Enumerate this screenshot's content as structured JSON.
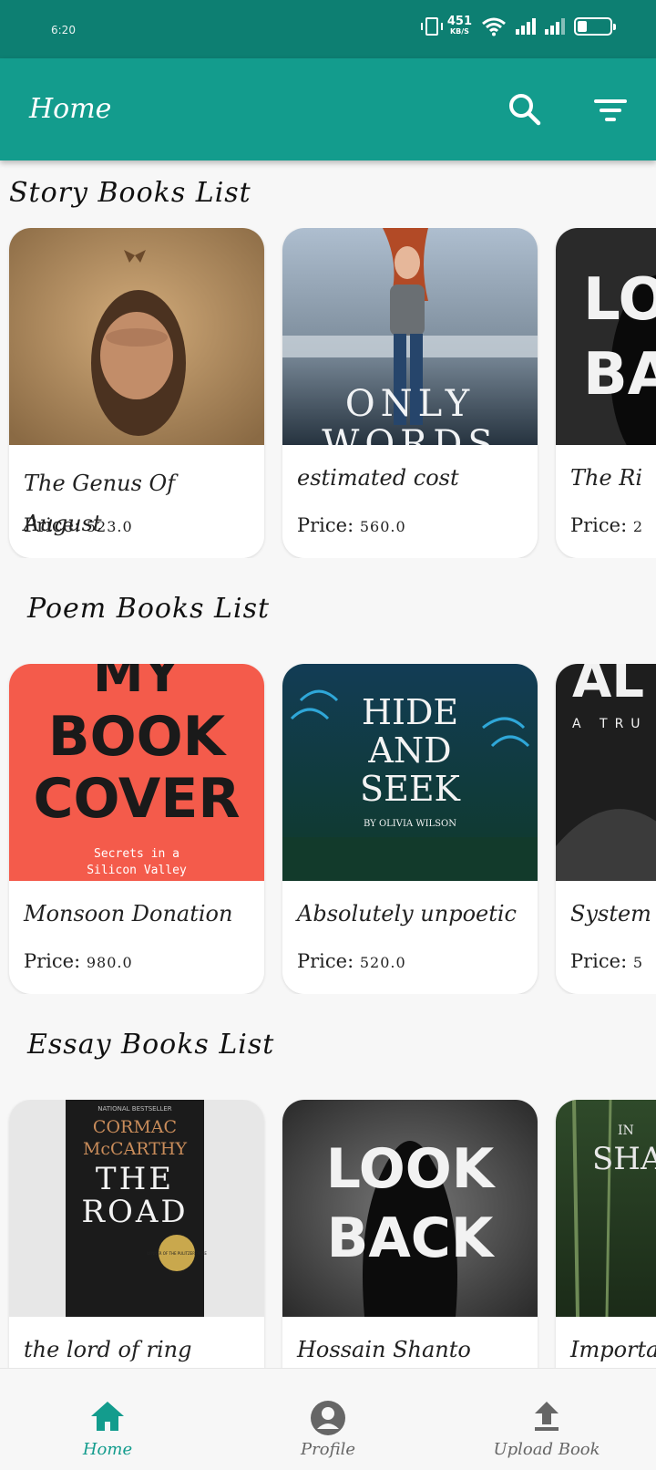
{
  "status_bar": {
    "time": "6:20",
    "net_speed": "451",
    "net_unit": "KB/S",
    "battery_level": "31"
  },
  "app_bar": {
    "title": "Home",
    "color": "#139c8d",
    "icons": [
      "search-icon",
      "filter-icon"
    ]
  },
  "sections": [
    {
      "title": "Story Books List",
      "books": [
        {
          "title_line1": "The Genus Of",
          "title_line2": "August",
          "price_label": "Price:",
          "price": "523.0"
        },
        {
          "title_line1": "estimated cost",
          "price_label": "Price:",
          "price": "560.0",
          "cover_text": [
            "ONLY",
            "WORDS"
          ]
        },
        {
          "title_line1": "The Ri",
          "price_label": "Price:",
          "price": "2",
          "cover_text": [
            "LO",
            "BA"
          ]
        }
      ]
    },
    {
      "title": "Poem Books List",
      "books": [
        {
          "title_line1": "Monsoon Donation",
          "price_label": "Price:",
          "price": "980.0",
          "cover_text": [
            "MY",
            "BOOK",
            "COVER",
            "Secrets in a",
            "Silicon Valley"
          ]
        },
        {
          "title_line1": "Absolutely unpoetic",
          "price_label": "Price:",
          "price": "520.0",
          "cover_text": [
            "HIDE",
            "AND",
            "SEEK",
            "BY OLIVIA WILSON"
          ]
        },
        {
          "title_line1": "System",
          "price_label": "Price:",
          "price": "5",
          "cover_text": [
            "AL",
            "A TRU"
          ]
        }
      ]
    },
    {
      "title": "Essay Books List",
      "books": [
        {
          "title_line1": "the lord of ring",
          "cover_text": [
            "NATIONAL BESTSELLER",
            "CORMAC",
            "McCARTHY",
            "THE",
            "ROAD",
            "WINNER OF THE PULITZER PRIZE"
          ]
        },
        {
          "title_line1": "Hossain Shanto",
          "cover_text": [
            "LOOK",
            "BACK"
          ]
        },
        {
          "title_line1": "Importa",
          "cover_text": [
            "IN",
            "SHA"
          ]
        }
      ]
    }
  ],
  "bottom_nav": {
    "items": [
      {
        "label": "Home",
        "icon": "home-icon",
        "active": true
      },
      {
        "label": "Profile",
        "icon": "profile-icon",
        "active": false
      },
      {
        "label": "Upload Book",
        "icon": "upload-icon",
        "active": false
      }
    ]
  }
}
